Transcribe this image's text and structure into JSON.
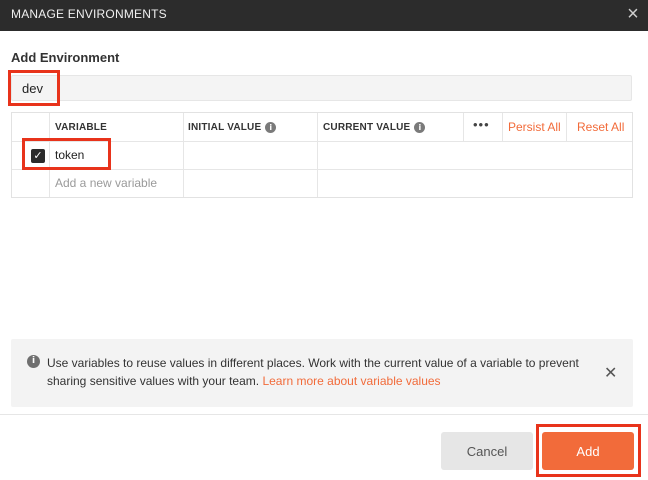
{
  "window": {
    "title": "MANAGE ENVIRONMENTS",
    "close_icon": "×"
  },
  "section": {
    "title": "Add Environment"
  },
  "environment": {
    "name": "dev"
  },
  "table": {
    "columns": {
      "variable": "VARIABLE",
      "initial_value": "INITIAL VALUE",
      "current_value": "CURRENT VALUE"
    },
    "more_icon": "•••",
    "persist_all": "Persist All",
    "reset_all": "Reset All",
    "rows": [
      {
        "checked": true,
        "variable": "token",
        "initial_value": "",
        "current_value": ""
      }
    ],
    "new_variable_placeholder": "Add a new variable"
  },
  "info": {
    "icon": "i",
    "message": "Use variables to reuse values in different places. Work with the current value of a variable to prevent sharing sensitive values with your team.",
    "link": "Learn more about variable values",
    "dismiss_icon": "✕"
  },
  "footer": {
    "cancel_label": "Cancel",
    "add_label": "Add"
  },
  "colors": {
    "accent": "#f26b3a",
    "highlight": "#e8331b",
    "titlebar": "#2c2c2c"
  }
}
